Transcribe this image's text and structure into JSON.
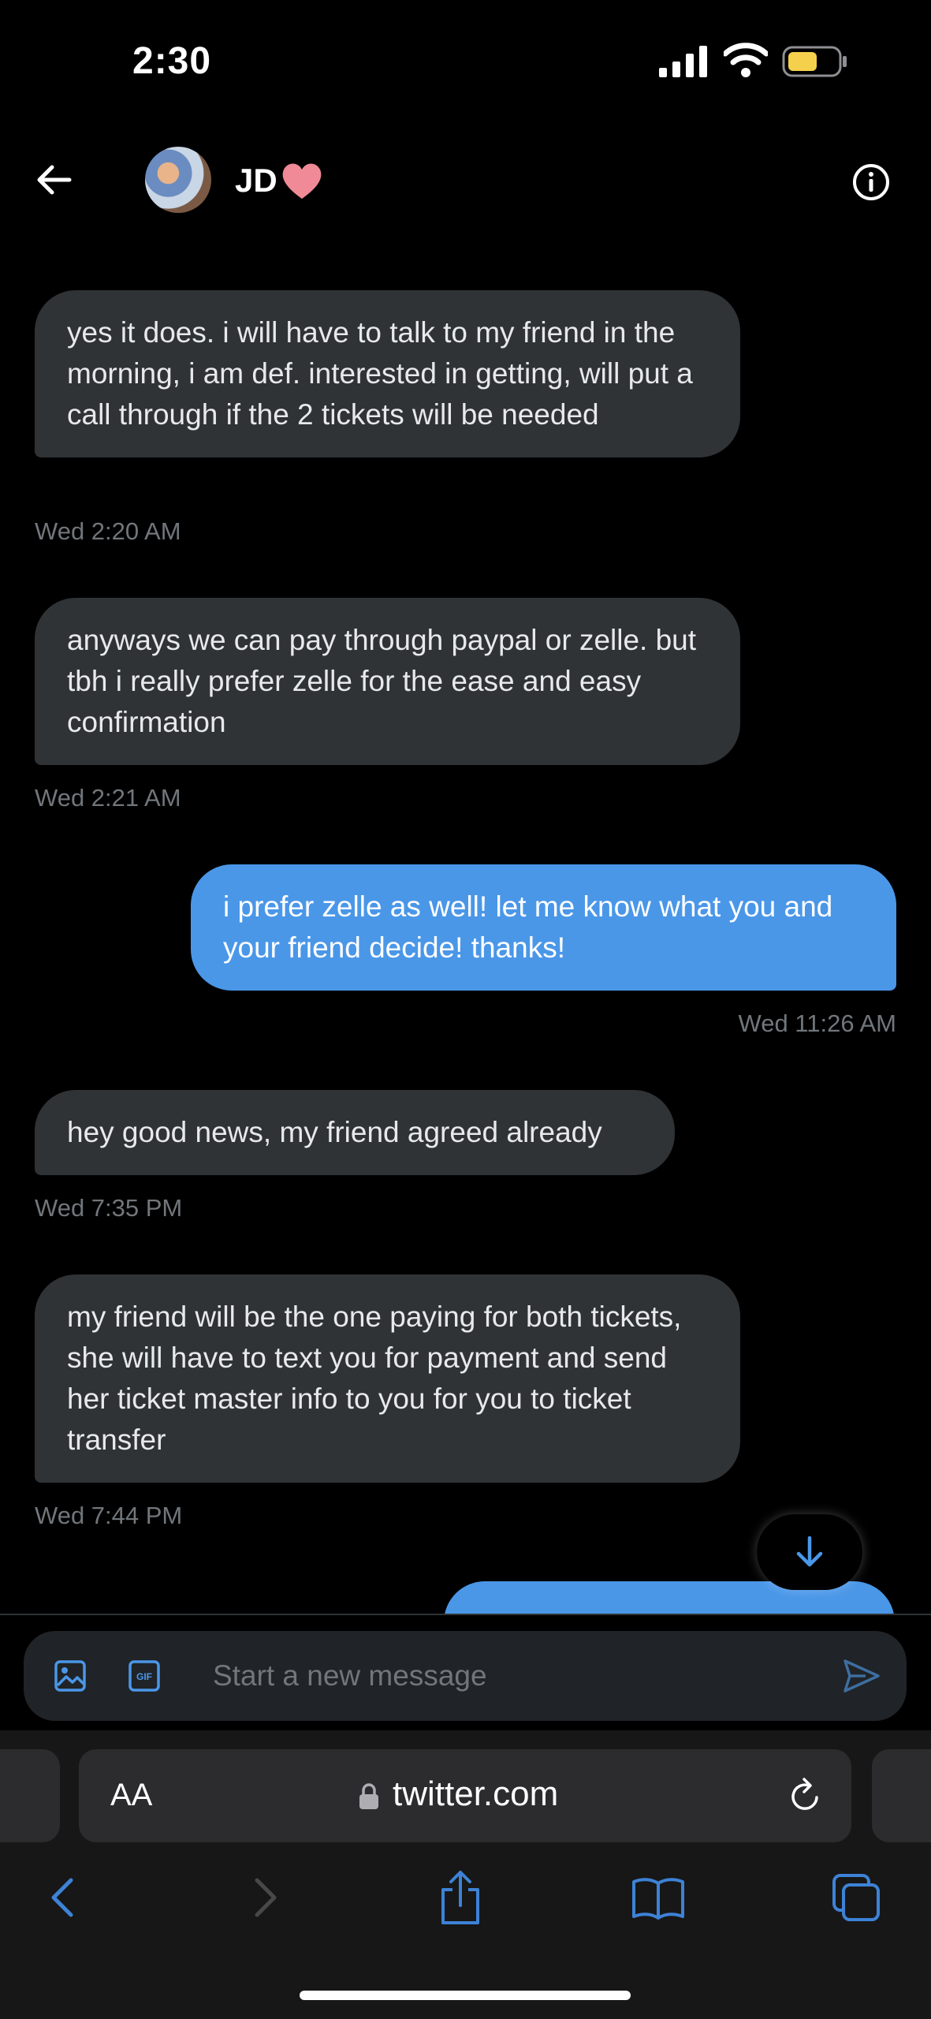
{
  "status_bar": {
    "time": "2:30"
  },
  "header": {
    "contact_name": "JD",
    "name_emoji": "heart"
  },
  "messages": [
    {
      "direction": "in",
      "text": "yes it does. i will have to talk to my friend in the morning, i am def. interested in getting, will put a call through if the 2 tickets will be needed",
      "time": "Wed 2:20 AM"
    },
    {
      "direction": "in",
      "text": "anyways we can pay through paypal or zelle. but tbh i really prefer zelle for the ease and easy confirmation",
      "time": "Wed 2:21 AM"
    },
    {
      "direction": "out",
      "text": "i prefer zelle as well! let me know what you and your friend decide! thanks!",
      "time": "Wed 11:26 AM"
    },
    {
      "direction": "in",
      "text": "hey good news, my friend agreed already",
      "time": "Wed 7:35 PM"
    },
    {
      "direction": "in",
      "text": "my friend will be the one paying for both tickets, she will have to text you for payment and send her ticket master info to you for you to ticket transfer",
      "time": "Wed 7:44 PM"
    }
  ],
  "composer": {
    "placeholder": "Start a new message"
  },
  "browser": {
    "text_size_label": "AA",
    "url": "twitter.com"
  },
  "colors": {
    "outgoing_bubble": "#4a97e8",
    "incoming_bubble": "#2f3336",
    "accent": "#1d9bf0",
    "battery": "#f5d04c"
  },
  "icons": [
    "back-arrow-icon",
    "info-icon",
    "image-icon",
    "gif-icon",
    "send-icon",
    "lock-icon",
    "reload-icon",
    "share-icon",
    "bookmarks-icon",
    "tabs-icon",
    "arrow-down-icon"
  ]
}
